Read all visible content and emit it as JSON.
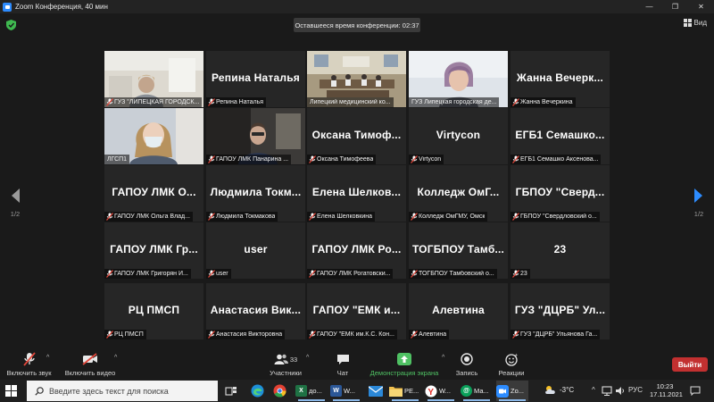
{
  "window": {
    "title": "Zoom Конференция, 40 мин"
  },
  "header": {
    "timer": "Оставшееся время конференции: 02:37",
    "view_label": "Вид"
  },
  "pagination": {
    "left_page": "1/2",
    "right_page": "1/2"
  },
  "tiles": [
    {
      "name": "ГУЗ \"ЛИПЕЦКАЯ ГОРОДСК...",
      "big": "",
      "video": "office",
      "mic_muted": true
    },
    {
      "name": "Репина Наталья",
      "big": "Репина Наталья",
      "video": "",
      "mic_muted": true
    },
    {
      "name": "Липецкий медицинский ко...",
      "big": "",
      "video": "classroom",
      "mic_muted": false,
      "active": true
    },
    {
      "name": "ГУЗ Липецкая городская де...",
      "big": "",
      "video": "woman",
      "mic_muted": false
    },
    {
      "name": "Жанна Вечеркина",
      "big": "Жанна Вечерк...",
      "video": "",
      "mic_muted": true
    },
    {
      "name": "ЛГСП1",
      "big": "",
      "video": "mask",
      "mic_muted": false
    },
    {
      "name": "ГАПОУ ЛМК Панарина ...",
      "big": "",
      "video": "dark",
      "mic_muted": true
    },
    {
      "name": "Оксана Тимофеева",
      "big": "Оксана Тимоф...",
      "video": "",
      "mic_muted": true
    },
    {
      "name": "Virtycon",
      "big": "Virtycon",
      "video": "",
      "mic_muted": true
    },
    {
      "name": "ЕГБ1 Семашко Аксенова...",
      "big": "ЕГБ1 Семашко...",
      "video": "",
      "mic_muted": true
    },
    {
      "name": "ГАПОУ ЛМК Ольга Влад...",
      "big": "ГАПОУ ЛМК О...",
      "video": "",
      "mic_muted": true
    },
    {
      "name": "Людмила Токмакова",
      "big": "Людмила Токм...",
      "video": "",
      "mic_muted": true
    },
    {
      "name": "Елена Шелковкина",
      "big": "Елена Шелков...",
      "video": "",
      "mic_muted": true
    },
    {
      "name": "Колледж ОмГМУ, Омск",
      "big": "Колледж ОмГ...",
      "video": "",
      "mic_muted": true
    },
    {
      "name": "ГБПОУ \"Свердловский о...",
      "big": "ГБПОУ \"Сверд...",
      "video": "",
      "mic_muted": true
    },
    {
      "name": "ГАПОУ ЛМК Григорян И...",
      "big": "ГАПОУ ЛМК Гр...",
      "video": "",
      "mic_muted": true
    },
    {
      "name": "user",
      "big": "user",
      "video": "",
      "mic_muted": true
    },
    {
      "name": "ГАПОУ ЛМК Рогатовски...",
      "big": "ГАПОУ ЛМК Ро...",
      "video": "",
      "mic_muted": true
    },
    {
      "name": "ТОГБПОУ Тамбовский о...",
      "big": "ТОГБПОУ Тамб...",
      "video": "",
      "mic_muted": true
    },
    {
      "name": "23",
      "big": "23",
      "video": "",
      "mic_muted": true
    },
    {
      "name": "РЦ ПМСП",
      "big": "РЦ ПМСП",
      "video": "",
      "mic_muted": true
    },
    {
      "name": "Анастасия Викторовна",
      "big": "Анастасия Вик...",
      "video": "",
      "mic_muted": true
    },
    {
      "name": "ГАПОУ \"ЕМК им.К.С. Кон...",
      "big": "ГАПОУ \"ЕМК и...",
      "video": "",
      "mic_muted": true
    },
    {
      "name": "Алевтина",
      "big": "Алевтина",
      "video": "",
      "mic_muted": true
    },
    {
      "name": "ГУЗ \"ДЦРБ\" Ульянова Га...",
      "big": "ГУЗ \"ДЦРБ\" Ул...",
      "video": "",
      "mic_muted": true
    }
  ],
  "toolbar": {
    "unmute": "Включить звук",
    "start_video": "Включить видео",
    "participants": "Участники",
    "participants_count": "33",
    "chat": "Чат",
    "share": "Демонстрация экрана",
    "record": "Запись",
    "reactions": "Реакции",
    "leave": "Выйти"
  },
  "taskbar": {
    "search_placeholder": "Введите здесь текст для поиска",
    "apps": [
      {
        "label": "",
        "icon": "task-view-icon"
      },
      {
        "label": "",
        "icon": "edge-icon"
      },
      {
        "label": "",
        "icon": "chrome-icon"
      },
      {
        "label": "до...",
        "icon": "excel-icon"
      },
      {
        "label": "W...",
        "icon": "word-icon"
      },
      {
        "label": "",
        "icon": "mail-icon"
      },
      {
        "label": "РЕ...",
        "icon": "folder-icon"
      },
      {
        "label": "W...",
        "icon": "yandex-icon"
      },
      {
        "label": "Ма...",
        "icon": "mailru-icon"
      },
      {
        "label": "Zo...",
        "icon": "zoom-icon"
      }
    ],
    "weather": "-3°C",
    "language": "РУС",
    "time": "10:23",
    "date": "17.11.2021"
  },
  "colors": {
    "accent_blue": "#2d8cff",
    "active_speaker": "#e6d43c",
    "leave_red": "#c23030",
    "share_green": "#4fc163",
    "muted_red": "#e0463a"
  }
}
